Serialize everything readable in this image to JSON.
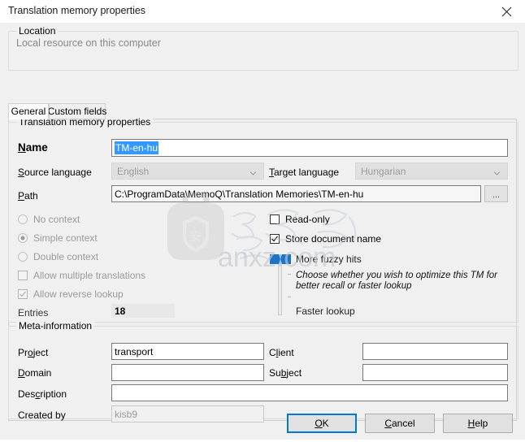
{
  "window": {
    "title": "Translation memory properties",
    "close_icon": "close-icon"
  },
  "location_group": {
    "legend": "Location",
    "text": "Local resource on this computer"
  },
  "tabs": [
    {
      "label": "General",
      "active": true
    },
    {
      "label": "Custom fields",
      "active": false
    }
  ],
  "tm_properties": {
    "legend": "Translation memory properties",
    "name_label": "Name",
    "name_value": "TM-en-hu",
    "source_language_label": "Source language",
    "source_language_value": "English",
    "target_language_label": "Target language",
    "target_language_value": "Hungarian",
    "path_label": "Path",
    "path_value": "C:\\ProgramData\\MemoQ\\Translation Memories\\TM-en-hu",
    "browse_label": "...",
    "context_options": [
      {
        "label": "No context",
        "selected": false
      },
      {
        "label": "Simple context",
        "selected": true
      },
      {
        "label": "Double context",
        "selected": false
      }
    ],
    "allow_multiple_label": "Allow multiple translations",
    "allow_multiple_checked": false,
    "allow_reverse_label": "Allow reverse lookup",
    "allow_reverse_checked": true,
    "entries_label": "Entries",
    "entries_value": "18",
    "read_only_label": "Read-only",
    "read_only_checked": false,
    "store_document_label": "Store document name",
    "store_document_checked": true,
    "slider_top_label": "More fuzzy hits",
    "slider_bottom_label": "Faster lookup",
    "slider_hint_line1": "Choose whether you wish to optimize this TM for",
    "slider_hint_line2": "better recall or faster lookup"
  },
  "meta_information": {
    "legend": "Meta-information",
    "project_label": "Project",
    "project_value": "transport",
    "client_label": "Client",
    "client_value": "",
    "domain_label": "Domain",
    "domain_value": "",
    "subject_label": "Subject",
    "subject_value": "",
    "description_label": "Description",
    "description_value": "",
    "created_by_label": "Created by",
    "created_by_value": "kisb9"
  },
  "footer": {
    "ok_label": "OK",
    "cancel_label": "Cancel",
    "help_label": "Help"
  },
  "watermark": {
    "text": "anxz.com",
    "glyph": "安"
  },
  "colors": {
    "accent": "#0078d7",
    "selection": "#3399ff",
    "dialog_bg": "#f0f0f0",
    "disabled_text": "#9a9a9a"
  }
}
